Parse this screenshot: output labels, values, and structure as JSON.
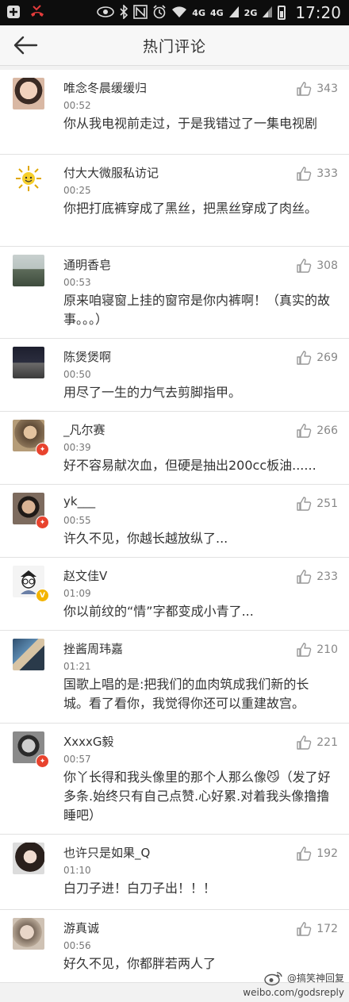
{
  "status_bar": {
    "time": "17:20",
    "network_1": "4G",
    "network_2": "4G",
    "network_3": "2G"
  },
  "header": {
    "title": "热门评论"
  },
  "comments": [
    {
      "username": "唯念冬晨缓缓归",
      "time": "00:52",
      "likes": "343",
      "text": "你从我电视前走过，于是我错过了一集电视剧",
      "avatar_color": "#c9a48c"
    },
    {
      "username": "付大大微服私访记",
      "time": "00:25",
      "likes": "333",
      "text": "你把打底裤穿成了黑丝，把黑丝穿成了肉丝。",
      "avatar_color": "#f3d23a"
    },
    {
      "username": "通明香皂",
      "time": "00:53",
      "likes": "308",
      "text": "原来咱寝窗上挂的窗帘是你内裤啊！（真实的故事。。。）",
      "avatar_color": "#7f8f7d"
    },
    {
      "username": "陈煲煲啊",
      "time": "00:50",
      "likes": "269",
      "text": "用尽了一生的力气去剪脚指甲。",
      "avatar_color": "#3a3a4a"
    },
    {
      "username": "_凡尔赛",
      "time": "00:39",
      "likes": "266",
      "text": "好不容易献次血，但硬是抽出200cc板油......",
      "avatar_color": "#a58a5e"
    },
    {
      "username": "yk___",
      "time": "00:55",
      "likes": "251",
      "text": "许久不见，你越长越放纵了...",
      "avatar_color": "#6b5a4c"
    },
    {
      "username": "赵文佳V",
      "time": "01:09",
      "likes": "233",
      "text": "你以前纹的“情”字都变成小青了...",
      "avatar_color": "#eaeaea"
    },
    {
      "username": "挫酱周玮嘉",
      "time": "01:21",
      "likes": "210",
      "text": "国歌上唱的是:把我们的血肉筑成我们新的长城。看了看你，我觉得你还可以重建故宫。",
      "avatar_color": "#4c6b88"
    },
    {
      "username": "XxxxG毅",
      "time": "00:57",
      "likes": "221",
      "text": "你丫长得和我头像里的那个人那么像😼（发了好多条.始终只有自己点赞.心好累.对着我头像撸撸睡吧）",
      "avatar_color": "#555555"
    },
    {
      "username": "也许只是如果_Q",
      "time": "01:10",
      "likes": "192",
      "text": "白刀子进！白刀子出！！！",
      "avatar_color": "#3f3530"
    },
    {
      "username": "游真诚",
      "time": "00:56",
      "likes": "172",
      "text": "好久不见，你都胖若两人了",
      "avatar_color": "#9c8b7a"
    }
  ],
  "watermark": {
    "handle": "@搞笑神回复",
    "url": "weibo.com/godsreply"
  }
}
